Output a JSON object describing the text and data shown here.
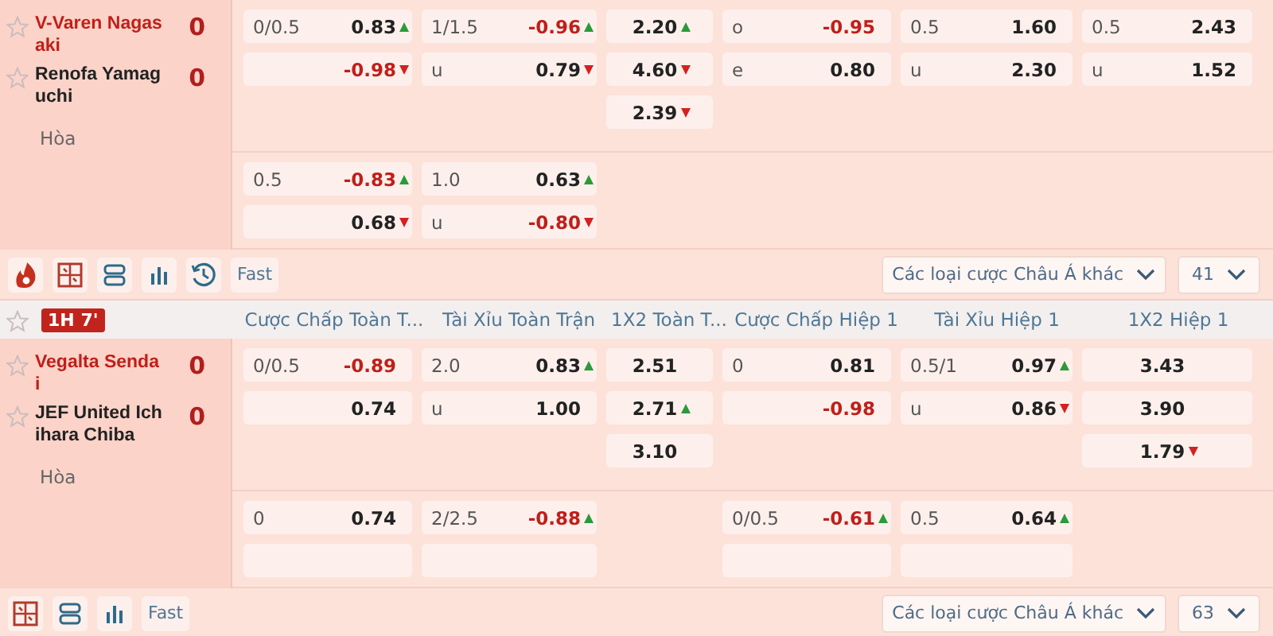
{
  "columns": [
    "Cược Chấp Toàn T...",
    "Tài Xỉu Toàn Trận",
    "1X2 Toàn T...",
    "Cược Chấp Hiệp 1",
    "Tài Xỉu Hiệp 1",
    "1X2 Hiệp 1"
  ],
  "matches": [
    {
      "teams": [
        {
          "name": "V-Varen Nagasaki",
          "score": "0",
          "highlighted": true,
          "favorite": false
        },
        {
          "name": "Renofa Yamaguchi",
          "score": "0",
          "highlighted": false,
          "favorite": false
        }
      ],
      "draw_label": "Hòa",
      "blocks": [
        [
          [
            {
              "kind": "handicap",
              "line": "0/0.5",
              "odds": "0.83",
              "negative": false,
              "trend_up": true,
              "trend_down": false
            },
            {
              "kind": "handicap",
              "line": "1/1.5",
              "odds": "-0.96",
              "negative": true,
              "trend_up": true,
              "trend_down": false
            },
            {
              "kind": "price",
              "odds": "2.20",
              "negative": false,
              "trend_up": true,
              "trend_down": false
            },
            {
              "kind": "handicap",
              "line": "o",
              "odds": "-0.95",
              "negative": true,
              "trend_up": false,
              "trend_down": false
            },
            {
              "kind": "handicap",
              "line": "0.5",
              "odds": "1.60",
              "negative": false,
              "trend_up": false,
              "trend_down": false
            },
            {
              "kind": "handicap",
              "line": "0.5",
              "odds": "2.43",
              "negative": false,
              "trend_up": false,
              "trend_down": false
            }
          ],
          [
            {
              "kind": "handicap",
              "odds": "-0.98",
              "negative": true,
              "trend_up": false,
              "trend_down": true
            },
            {
              "kind": "handicap",
              "line": "u",
              "odds": "0.79",
              "negative": false,
              "trend_up": false,
              "trend_down": true
            },
            {
              "kind": "price",
              "odds": "4.60",
              "negative": false,
              "trend_up": false,
              "trend_down": true
            },
            {
              "kind": "handicap",
              "line": "e",
              "odds": "0.80",
              "negative": false,
              "trend_up": false,
              "trend_down": false
            },
            {
              "kind": "handicap",
              "line": "u",
              "odds": "2.30",
              "negative": false,
              "trend_up": false,
              "trend_down": false
            },
            {
              "kind": "handicap",
              "line": "u",
              "odds": "1.52",
              "negative": false,
              "trend_up": false,
              "trend_down": false
            }
          ],
          [
            {
              "kind": "blank"
            },
            {
              "kind": "blank"
            },
            {
              "kind": "price",
              "odds": "2.39",
              "negative": false,
              "trend_up": false,
              "trend_down": true
            },
            {
              "kind": "blank"
            },
            {
              "kind": "blank"
            },
            {
              "kind": "blank"
            }
          ]
        ],
        [
          [
            {
              "kind": "handicap",
              "line": "0.5",
              "odds": "-0.83",
              "negative": true,
              "trend_up": true,
              "trend_down": false
            },
            {
              "kind": "handicap",
              "line": "1.0",
              "odds": "0.63",
              "negative": false,
              "trend_up": true,
              "trend_down": false
            },
            {
              "kind": "blank"
            },
            {
              "kind": "blank"
            },
            {
              "kind": "blank"
            },
            {
              "kind": "blank"
            }
          ],
          [
            {
              "kind": "handicap",
              "odds": "0.68",
              "negative": false,
              "trend_up": false,
              "trend_down": true
            },
            {
              "kind": "handicap",
              "line": "u",
              "odds": "-0.80",
              "negative": true,
              "trend_up": false,
              "trend_down": true
            },
            {
              "kind": "blank"
            },
            {
              "kind": "blank"
            },
            {
              "kind": "blank"
            },
            {
              "kind": "blank"
            }
          ]
        ]
      ],
      "toolbar": {
        "icons": [
          {
            "kind": "fire"
          },
          {
            "kind": "grid"
          },
          {
            "kind": "layers"
          },
          {
            "kind": "chart"
          },
          {
            "kind": "clock"
          }
        ],
        "fast": "Fast",
        "market_select": "Các loại cược Châu Á khác",
        "count": "41"
      }
    },
    {
      "favorite": false,
      "time": "1H 7'",
      "teams": [
        {
          "name": "Vegalta Sendai",
          "score": "0",
          "highlighted": true,
          "favorite": false
        },
        {
          "name": "JEF United Ichihara Chiba",
          "score": "0",
          "highlighted": false,
          "favorite": false
        }
      ],
      "draw_label": "Hòa",
      "blocks": [
        [
          [
            {
              "kind": "handicap",
              "line": "0/0.5",
              "odds": "-0.89",
              "negative": true,
              "trend_up": false,
              "trend_down": false
            },
            {
              "kind": "handicap",
              "line": "2.0",
              "odds": "0.83",
              "negative": false,
              "trend_up": true,
              "trend_down": false
            },
            {
              "kind": "price",
              "odds": "2.51",
              "negative": false,
              "trend_up": false,
              "trend_down": false
            },
            {
              "kind": "handicap",
              "line": "0",
              "odds": "0.81",
              "negative": false,
              "trend_up": false,
              "trend_down": false
            },
            {
              "kind": "handicap",
              "line": "0.5/1",
              "odds": "0.97",
              "negative": false,
              "trend_up": true,
              "trend_down": false
            },
            {
              "kind": "price",
              "odds": "3.43",
              "negative": false,
              "trend_up": false,
              "trend_down": false
            }
          ],
          [
            {
              "kind": "handicap",
              "odds": "0.74",
              "negative": false,
              "trend_up": false,
              "trend_down": false
            },
            {
              "kind": "handicap",
              "line": "u",
              "odds": "1.00",
              "negative": false,
              "trend_up": false,
              "trend_down": false
            },
            {
              "kind": "price",
              "odds": "2.71",
              "negative": false,
              "trend_up": true,
              "trend_down": false
            },
            {
              "kind": "handicap",
              "odds": "-0.98",
              "negative": true,
              "trend_up": false,
              "trend_down": false
            },
            {
              "kind": "handicap",
              "line": "u",
              "odds": "0.86",
              "negative": false,
              "trend_up": false,
              "trend_down": true
            },
            {
              "kind": "price",
              "odds": "3.90",
              "negative": false,
              "trend_up": false,
              "trend_down": false
            }
          ],
          [
            {
              "kind": "blank"
            },
            {
              "kind": "blank"
            },
            {
              "kind": "price",
              "odds": "3.10",
              "negative": false,
              "trend_up": false,
              "trend_down": false
            },
            {
              "kind": "blank"
            },
            {
              "kind": "blank"
            },
            {
              "kind": "price",
              "odds": "1.79",
              "negative": false,
              "trend_up": false,
              "trend_down": true
            }
          ]
        ],
        [
          [
            {
              "kind": "handicap",
              "line": "0",
              "odds": "0.74",
              "negative": false,
              "trend_up": false,
              "trend_down": false
            },
            {
              "kind": "handicap",
              "line": "2/2.5",
              "odds": "-0.88",
              "negative": true,
              "trend_up": true,
              "trend_down": false
            },
            {
              "kind": "blank"
            },
            {
              "kind": "handicap",
              "line": "0/0.5",
              "odds": "-0.61",
              "negative": true,
              "trend_up": true,
              "trend_down": false
            },
            {
              "kind": "handicap",
              "line": "0.5",
              "odds": "0.64",
              "negative": false,
              "trend_up": true,
              "trend_down": false
            },
            {
              "kind": "blank"
            }
          ],
          [
            {
              "kind": "handicap"
            },
            {
              "kind": "handicap"
            },
            {
              "kind": "blank"
            },
            {
              "kind": "handicap"
            },
            {
              "kind": "handicap"
            },
            {
              "kind": "blank"
            }
          ]
        ]
      ],
      "toolbar": {
        "icons": [
          {
            "kind": "grid"
          },
          {
            "kind": "layers"
          },
          {
            "kind": "chart"
          }
        ],
        "fast": "Fast",
        "market_select": "Các loại cược Châu Á khác",
        "count": "63"
      }
    }
  ]
}
